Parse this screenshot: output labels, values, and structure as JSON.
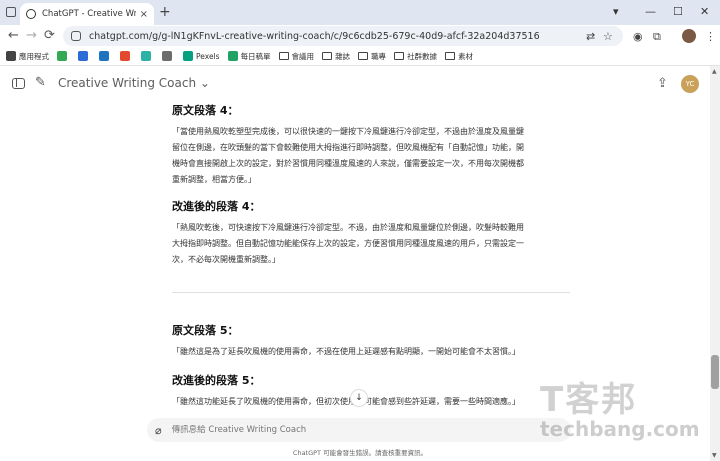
{
  "browser": {
    "tab_title": "ChatGPT - Creative Writing C",
    "tab_close": "×",
    "new_tab": "+",
    "url": "chatgpt.com/g/g-lN1gKFnvL-creative-writing-coach/c/9c6cdb25-679c-40d9-afcf-32a204d37516",
    "window_controls": [
      "▾",
      "—",
      "☐",
      "✕"
    ],
    "nav": {
      "back": "←",
      "forward": "→",
      "reload": "⟳"
    },
    "toolbar_icons": [
      "translate-icon",
      "star-icon",
      "extension-icon",
      "puzzle-icon",
      "profile-icon",
      "menu-icon"
    ]
  },
  "bookmarks": [
    {
      "label": "應用程式",
      "icon": "apps-icon",
      "color": "#444444"
    },
    {
      "label": "",
      "icon": "green-leaf-icon",
      "color": "#35a853"
    },
    {
      "label": "",
      "icon": "blue-square-icon",
      "color": "#2b6bd6"
    },
    {
      "label": "",
      "icon": "c-icon",
      "color": "#1e73be"
    },
    {
      "label": "",
      "icon": "chart-icon",
      "color": "#e24a2f"
    },
    {
      "label": "",
      "icon": "s-icon",
      "color": "#2cb3a5"
    },
    {
      "label": "",
      "icon": "globe-icon",
      "color": "#6c6c6c"
    },
    {
      "label": "Pexels",
      "icon": "pexels-icon",
      "color": "#05a081"
    },
    {
      "label": "每日稿單",
      "icon": "sheet-icon",
      "color": "#1ea362"
    },
    {
      "label": "會議用",
      "icon": "folder-icon",
      "color": "#444444"
    },
    {
      "label": "雜誌",
      "icon": "folder-icon",
      "color": "#444444"
    },
    {
      "label": "職專",
      "icon": "folder-icon",
      "color": "#444444"
    },
    {
      "label": "社群數據",
      "icon": "folder-icon",
      "color": "#444444"
    },
    {
      "label": "素材",
      "icon": "folder-icon",
      "color": "#444444"
    }
  ],
  "app": {
    "model_name": "Creative Writing Coach ⌄",
    "user_initials": "YC",
    "avatar_color": "#c9a15a"
  },
  "sections": [
    {
      "heading": "原文段落 4：",
      "lines": [
        "「當使用熱風吹乾塑型完成後，可以很快速的一鍵按下冷風鍵進行冷卻定型，不過由於溫度及風量鍵",
        "留位在側邊，在吹頭髮的當下會較難使用大拇指進行即時調整，但吹風機配有「自動記憶」功能，開",
        "機時會直接開啟上次的設定，對於習慣用同種溫度風速的人來說，僅需要設定一次，不用每次開機都",
        "重新調整，相當方便。」"
      ]
    },
    {
      "heading": "改進後的段落 4：",
      "lines": [
        "「熱風吹乾後，可快速按下冷風鍵進行冷卻定型。不過，由於溫度和風量鍵位於側邊，吹髮時較難用",
        "大拇指即時調整。但自動記憶功能能保存上次的設定，方便習慣用同種溫度風速的用戶，只需設定一",
        "次，不必每次開機重新調整。」"
      ]
    },
    {
      "heading": "原文段落 5：",
      "lines": [
        "「雖然這是為了延長吹風機的使用壽命，不過在使用上延遲感有點明顯，一開始可能會不太習慣。」"
      ]
    },
    {
      "heading": "改進後的段落 5：",
      "lines": [
        "「雖然這功能延長了吹風機的使用壽命，但初次使用時可能會感到些許延遲，需要一些時間適應。」"
      ]
    }
  ],
  "composer": {
    "placeholder": "傳訊息給 Creative Writing Coach",
    "attach_icon": "paperclip-icon"
  },
  "footer_note": "ChatGPT 可能會發生錯誤。請查核重要資訊。",
  "watermark": {
    "logo": "T客邦",
    "text": "techbang.com"
  }
}
